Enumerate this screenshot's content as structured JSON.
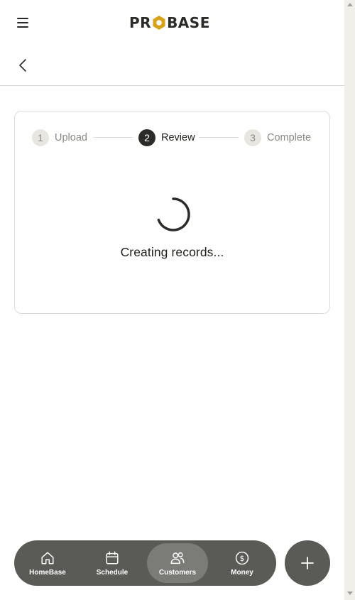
{
  "header": {
    "logo_text": [
      "PR",
      "BASE"
    ],
    "menu_icon": "hamburger-menu-icon",
    "back_icon": "chevron-left-icon"
  },
  "stepper": {
    "steps": [
      {
        "number": "1",
        "label": "Upload",
        "state": "inactive"
      },
      {
        "number": "2",
        "label": "Review",
        "state": "active"
      },
      {
        "number": "3",
        "label": "Complete",
        "state": "inactive"
      }
    ]
  },
  "status": {
    "loading_text": "Creating records...",
    "spinner_icon": "loading-spinner-icon"
  },
  "bottom_nav": {
    "items": [
      {
        "label": "HomeBase",
        "icon": "house-icon",
        "active": false
      },
      {
        "label": "Schedule",
        "icon": "calendar-icon",
        "active": false
      },
      {
        "label": "Customers",
        "icon": "users-icon",
        "active": true
      },
      {
        "label": "Money",
        "icon": "dollar-circle-icon",
        "active": false
      }
    ],
    "fab_icon": "plus-icon"
  },
  "colors": {
    "brand_dark": "#2b2b29",
    "brand_accent": "#d9a21b",
    "nav_background": "#5a5a57",
    "nav_active": "#7b7b78",
    "step_inactive": "#e8e6e0",
    "border": "#dedcd6"
  }
}
